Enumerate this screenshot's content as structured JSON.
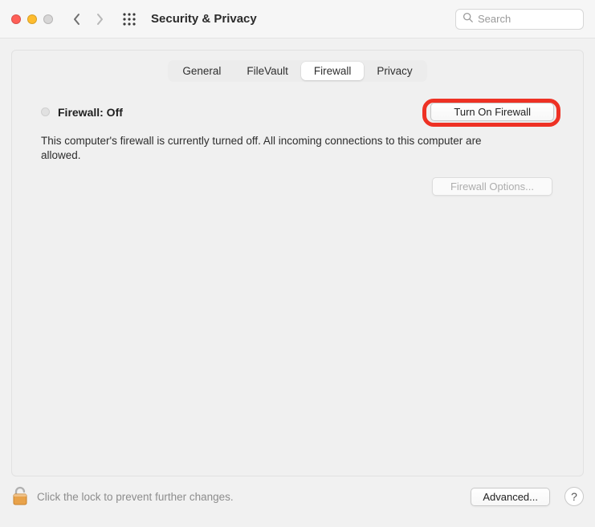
{
  "header": {
    "title": "Security & Privacy",
    "search_placeholder": "Search"
  },
  "tabs": {
    "general": "General",
    "filevault": "FileVault",
    "firewall": "Firewall",
    "privacy": "Privacy",
    "active": "firewall"
  },
  "firewall": {
    "status_title": "Firewall: Off",
    "turn_on_label": "Turn On Firewall",
    "description": "This computer's firewall is currently turned off. All incoming connections to this computer are allowed.",
    "options_label": "Firewall Options..."
  },
  "footer": {
    "lock_text": "Click the lock to prevent further changes.",
    "advanced_label": "Advanced...",
    "help_label": "?"
  }
}
